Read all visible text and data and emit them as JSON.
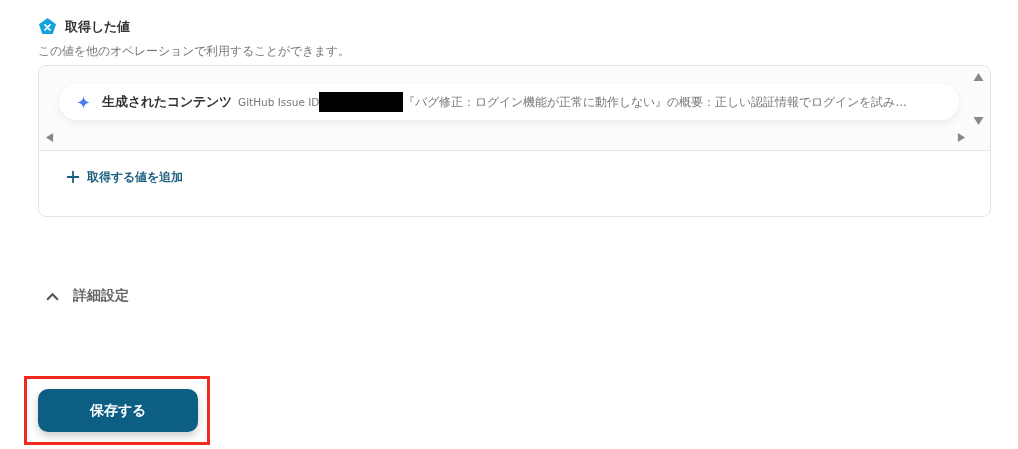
{
  "section": {
    "title": "取得した値",
    "description": "この値を他のオペレーションで利用することができます。"
  },
  "values": [
    {
      "label": "生成されたコンテンツ",
      "value_before": "GitHub Issue ID",
      "value_after": "『バグ修正：ログイン機能が正常に動作しない』の概要：正しい認証情報でログインを試み..."
    }
  ],
  "add_link": "取得する値を追加",
  "details": {
    "label": "詳細設定"
  },
  "save_button": "保存する"
}
